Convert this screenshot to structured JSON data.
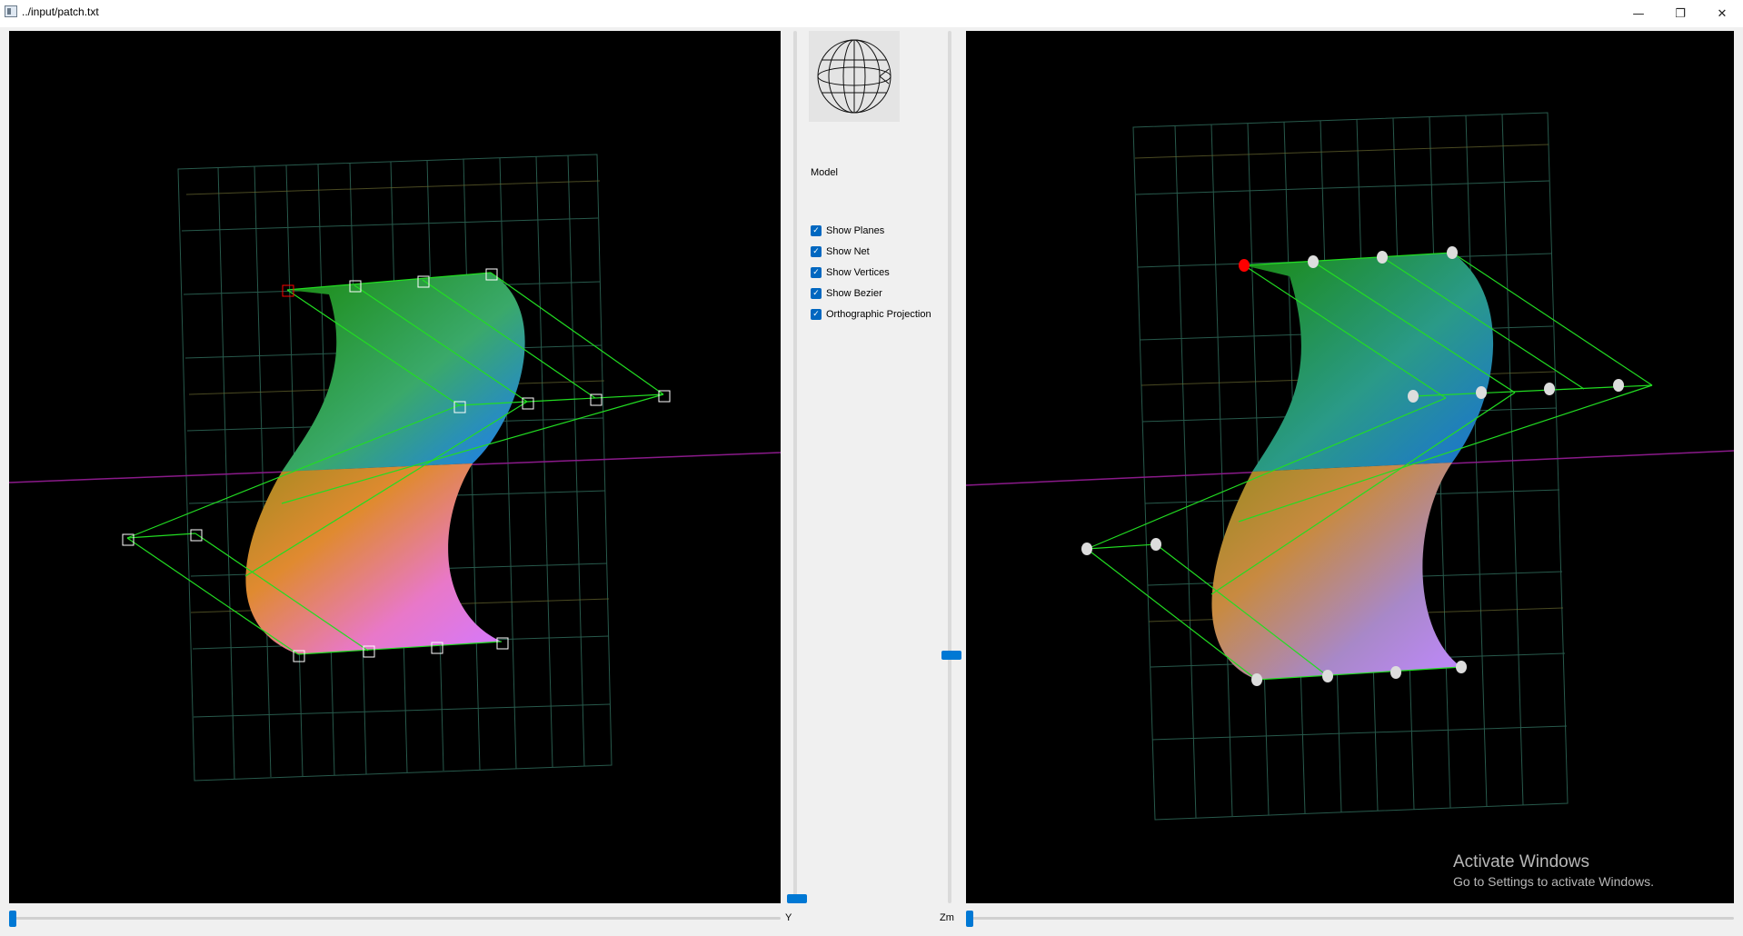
{
  "window": {
    "title": "../input/patch.txt",
    "minimize_icon": "minimize-icon",
    "restore_icon": "restore-icon",
    "close_icon": "close-icon"
  },
  "controls": {
    "model_label": "Model",
    "checkboxes": [
      {
        "label": "Show Planes",
        "checked": true
      },
      {
        "label": "Show Net",
        "checked": true
      },
      {
        "label": "Show Vertices",
        "checked": true
      },
      {
        "label": "Show Bezier",
        "checked": true
      },
      {
        "label": "Orthographic Projection",
        "checked": true
      }
    ]
  },
  "sliders": {
    "y_label": "Y",
    "zm_label": "Zm"
  },
  "watermark": {
    "line1": "Activate Windows",
    "line2": "Go to Settings to activate Windows."
  },
  "colors": {
    "selected_vertex": "#ff0000",
    "net": "#00ff00",
    "axis": "#8a1a8a",
    "accent": "#0078d4"
  }
}
